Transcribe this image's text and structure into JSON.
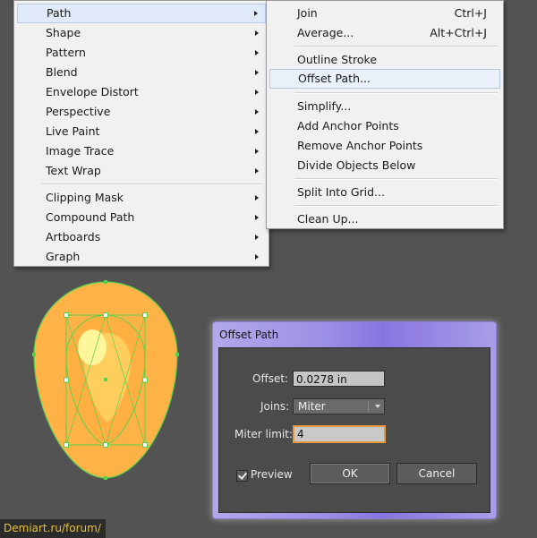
{
  "menu": {
    "items": [
      {
        "label": "Path",
        "submenu": true,
        "highlighted": true
      },
      {
        "label": "Shape",
        "submenu": true
      },
      {
        "label": "Pattern",
        "submenu": true
      },
      {
        "label": "Blend",
        "submenu": true
      },
      {
        "label": "Envelope Distort",
        "submenu": true
      },
      {
        "label": "Perspective",
        "submenu": true
      },
      {
        "label": "Live Paint",
        "submenu": true
      },
      {
        "label": "Image Trace",
        "submenu": true
      },
      {
        "label": "Text Wrap",
        "submenu": true
      },
      {
        "label": "Clipping Mask",
        "submenu": true
      },
      {
        "label": "Compound Path",
        "submenu": true
      },
      {
        "label": "Artboards",
        "submenu": true
      },
      {
        "label": "Graph",
        "submenu": true
      }
    ]
  },
  "submenu": {
    "items": [
      {
        "label": "Join",
        "shortcut": "Ctrl+J"
      },
      {
        "label": "Average...",
        "shortcut": "Alt+Ctrl+J"
      },
      {
        "label": "Outline Stroke",
        "shortcut": ""
      },
      {
        "label": "Offset Path...",
        "shortcut": "",
        "highlighted": true
      },
      {
        "label": "Simplify...",
        "shortcut": ""
      },
      {
        "label": "Add Anchor Points",
        "shortcut": ""
      },
      {
        "label": "Remove Anchor Points",
        "shortcut": ""
      },
      {
        "label": "Divide Objects Below",
        "shortcut": ""
      },
      {
        "label": "Split Into Grid...",
        "shortcut": ""
      },
      {
        "label": "Clean Up...",
        "shortcut": ""
      }
    ]
  },
  "dialog": {
    "title": "Offset Path",
    "offset_label": "Offset:",
    "offset_value": "0.0278 in",
    "joins_label": "Joins:",
    "joins_value": "Miter",
    "miter_label": "Miter limit:",
    "miter_value": "4",
    "preview_label": "Preview",
    "preview_checked": true,
    "ok_label": "OK",
    "cancel_label": "Cancel"
  },
  "watermark": "Demiart.ru/forum/",
  "colors": {
    "canvas": "#535353",
    "menu_bg": "#f1f1f1",
    "egg_fill": "#ffb347",
    "selection": "#4fd14f",
    "dialog_accent": "#8874e0"
  }
}
